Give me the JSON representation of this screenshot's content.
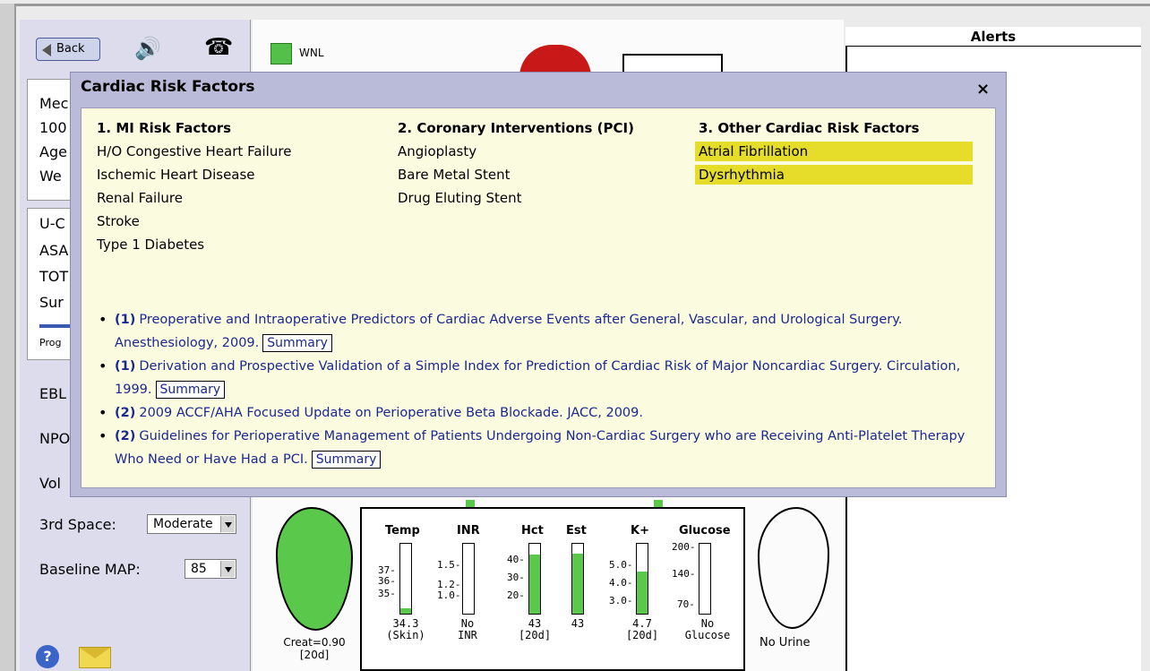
{
  "toolbar": {
    "back_label": "Back"
  },
  "sidebar": {
    "info_lines": [
      "Mec",
      "100",
      "Age",
      "We"
    ],
    "lines2": [
      "U-C",
      "ASA",
      "TOT",
      "Sur"
    ],
    "progress_label": "Prog",
    "labels": {
      "ebl": "EBL",
      "npo": "NPO",
      "vol": "Vol",
      "third_space": "3rd Space:",
      "baseline_map": "Baseline MAP:"
    },
    "third_space_value": "Moderate",
    "baseline_map_value": "85"
  },
  "center": {
    "wnl_label": "WNL",
    "creat_label": "Creat=0.90",
    "creat_sub": "[20d]",
    "no_urine": "No Urine",
    "labs": {
      "headers": [
        "Temp",
        "INR",
        "Hct",
        "Est",
        "K+",
        "Glucose"
      ],
      "temp_ticks": [
        "37-",
        "36-",
        "35-"
      ],
      "inr_ticks": [
        "1.5-",
        "1.2-",
        "1.0-"
      ],
      "hct_ticks": [
        "40-",
        "30-",
        "20-"
      ],
      "k_ticks": [
        "5.0-",
        "4.0-",
        "3.0-"
      ],
      "glucose_ticks": [
        "200-",
        "140-",
        "70-"
      ],
      "temp_val": "34.3",
      "temp_sub": "(Skin)",
      "inr_val": "No",
      "inr_sub": "INR",
      "hct_val": "43",
      "hct_sub": "[20d]",
      "est_val": "43",
      "k_val": "4.7",
      "k_sub": "[20d]",
      "glucose_val": "No",
      "glucose_sub": "Glucose",
      "fills": {
        "temp": 0.08,
        "hct": 0.85,
        "est": 0.86,
        "k": 0.6
      }
    }
  },
  "alerts": {
    "title": "Alerts"
  },
  "modal": {
    "title": "Cardiac Risk Factors",
    "close": "×",
    "columns": [
      {
        "title": "1. MI Risk Factors",
        "items": [
          "H/O Congestive Heart Failure",
          "Ischemic Heart Disease",
          "Renal Failure",
          "Stroke",
          "Type 1 Diabetes"
        ]
      },
      {
        "title": "2. Coronary Interventions (PCI)",
        "items": [
          "Angioplasty",
          "Bare Metal Stent",
          "Drug Eluting Stent"
        ]
      },
      {
        "title": "3. Other Cardiac Risk Factors",
        "items": [
          "Atrial Fibrillation",
          "Dysrhythmia"
        ]
      }
    ],
    "references": [
      {
        "level": "(1)",
        "text": "Preoperative and Intraoperative Predictors of Cardiac Adverse Events after General, Vascular, and Urological Surgery. Anesthesiology, 2009.",
        "summary": "Summary"
      },
      {
        "level": "(1)",
        "text": "Derivation and Prospective Validation of a Simple Index for Prediction of Cardiac Risk of Major Noncardiac Surgery. Circulation, 1999.",
        "summary": "Summary"
      },
      {
        "level": "(2)",
        "text": "2009 ACCF/AHA Focused Update on Perioperative Beta Blockade. JACC, 2009.",
        "summary": ""
      },
      {
        "level": "(2)",
        "text": "Guidelines for Perioperative Management of Patients Undergoing Non-Cardiac Surgery who are Receiving Anti-Platelet Therapy Who Need or Have Had a PCI.",
        "summary": "Summary"
      }
    ]
  },
  "colors": {
    "highlight": "#e6dc2a",
    "gauge_fill": "#5ac84a",
    "link": "#1a2890"
  }
}
